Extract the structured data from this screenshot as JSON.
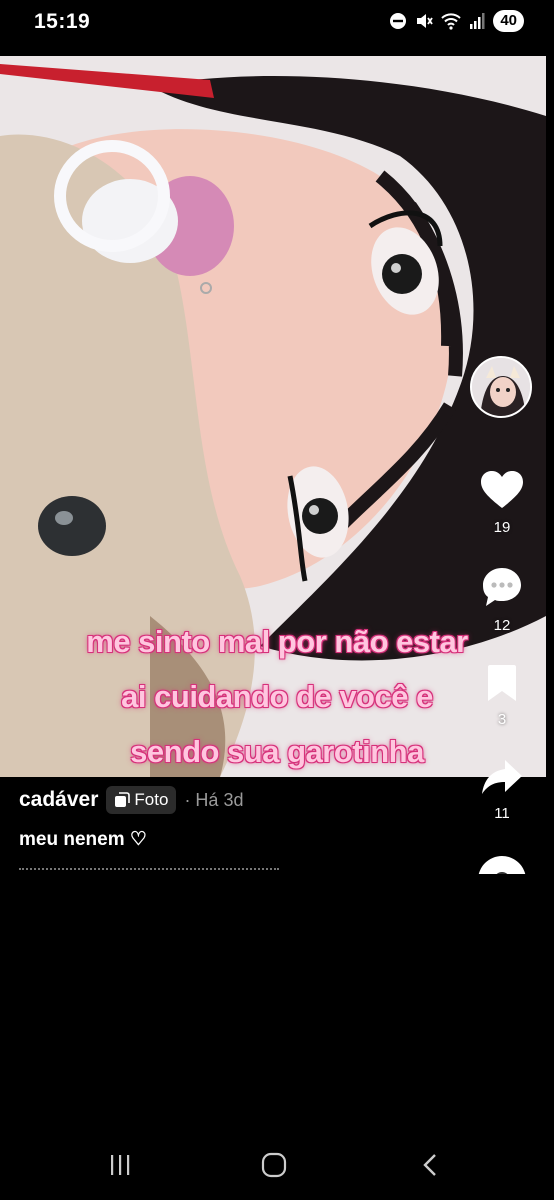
{
  "status_bar": {
    "time": "15:19",
    "battery": "40",
    "icons": [
      "do-not-disturb-icon",
      "mute-icon",
      "wifi-icon",
      "signal-icon",
      "battery-icon"
    ]
  },
  "post": {
    "overlay_lines": [
      "me sinto mal por não estar",
      "ai cuidando de você e",
      "sendo sua garotinha"
    ],
    "author": "cadáver",
    "type_badge": "Foto",
    "time": "· Há 3d",
    "description": "meu nenem ♡"
  },
  "actions": {
    "likes": "19",
    "comments": "12",
    "saves": "3",
    "shares": "11"
  },
  "colors": {
    "overlay_text": "#ffc6df",
    "overlay_outline": "#d7317b",
    "background": "#000000"
  }
}
